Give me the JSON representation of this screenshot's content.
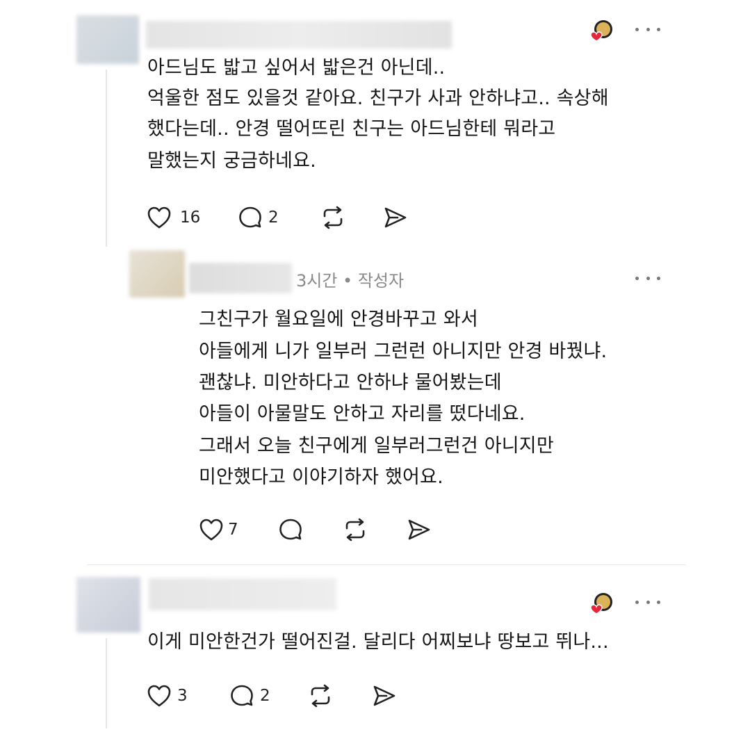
{
  "comments": [
    {
      "lines": [
        "아드님도 밟고 싶어서 밟은건 아닌데..",
        "억울한 점도 있을것 같아요. 친구가 사과 안하냐고.. 속상해",
        "했다는데.. 안경 떨어뜨린 친구는 아드님한테 뭐라고",
        "말했는지 궁금하네요."
      ],
      "likes": "16",
      "replies": "2"
    },
    {
      "meta": "3시간 • 작성자",
      "lines": [
        "그친구가 월요일에 안경바꾸고 와서",
        "아들에게 니가 일부러 그런런 아니지만 안경 바꿨냐.",
        "괜찮냐. 미안하다고 안하냐 물어봤는데",
        "아들이 아물말도 안하고 자리를 떴다네요.",
        "그래서 오늘 친구에게 일부러그런건 아니지만",
        "미안했다고 이야기하자 했어요."
      ],
      "likes": "7",
      "replies": ""
    },
    {
      "lines": [
        "이게 미안한건가 떨어진걸. 달리다 어찌보냐 땅보고 뛰나..."
      ],
      "likes": "3",
      "replies": "2"
    }
  ],
  "icons": {
    "like": "heart-icon",
    "reply": "comment-icon",
    "repost": "repost-icon",
    "share": "send-icon",
    "more": "more-dots-icon",
    "badge": "liked-by-author-badge"
  },
  "colors": {
    "accent_heart": "#e8263a",
    "text": "#151515",
    "muted": "#8a8a8a"
  }
}
